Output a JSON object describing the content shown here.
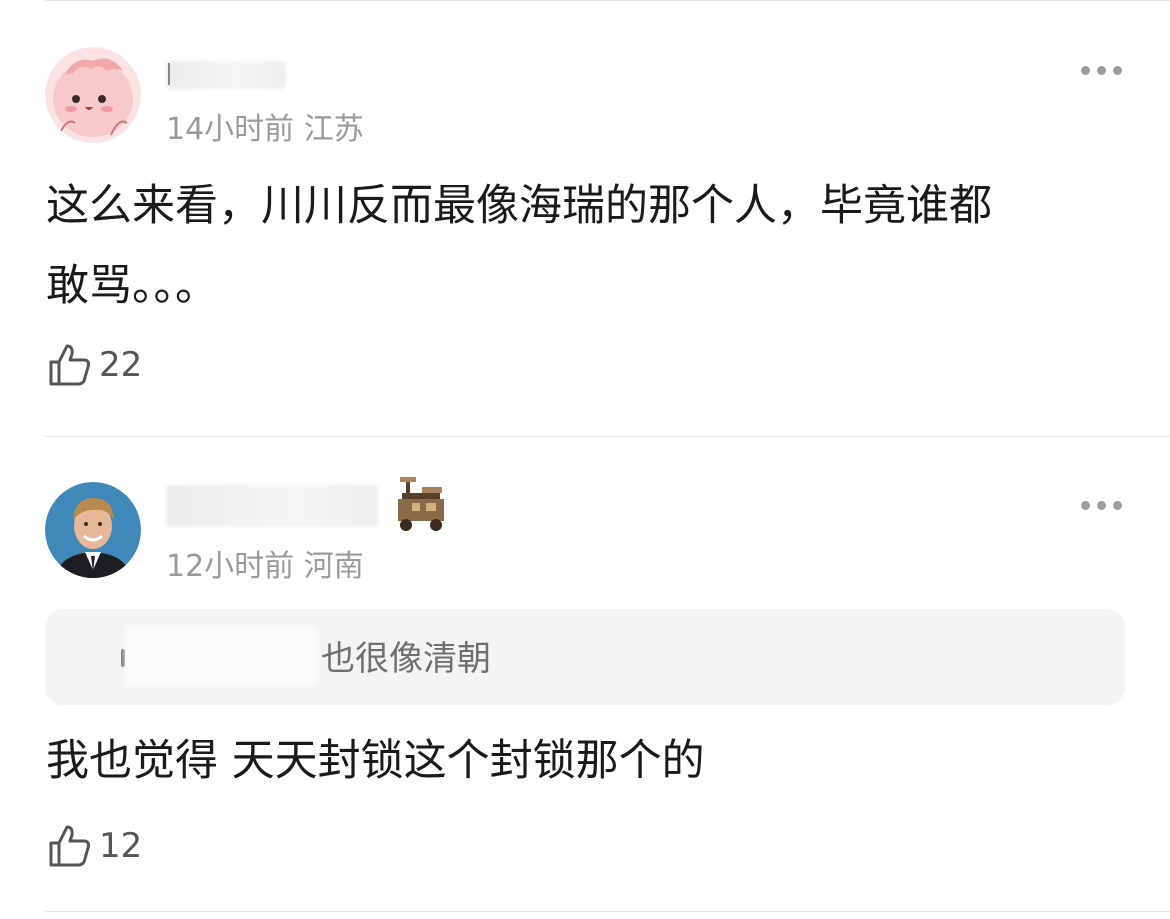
{
  "comments": [
    {
      "time": "14小时前",
      "location": "江苏",
      "text_line1": "这么来看，川川反而最像海瑞的那个人，毕竟谁都",
      "text_line2": "敢骂。。。",
      "likes": "22",
      "avatar_icon": "pink-cartoon-avatar",
      "more_icon": "more-dots-icon",
      "like_icon": "thumbs-up-icon"
    },
    {
      "time": "12小时前",
      "location": "河南",
      "quote_text": "也很像清朝",
      "text": "我也觉得 天天封锁这个封锁那个的",
      "likes": "12",
      "avatar_icon": "man-portrait-avatar",
      "badge_icon": "pixel-cart-badge-icon",
      "more_icon": "more-dots-icon",
      "like_icon": "thumbs-up-icon"
    }
  ],
  "colors": {
    "text": "#1a1a1a",
    "meta": "#9a9a9a",
    "quote_bg": "#f4f4f4",
    "divider": "#e3e3e3"
  }
}
